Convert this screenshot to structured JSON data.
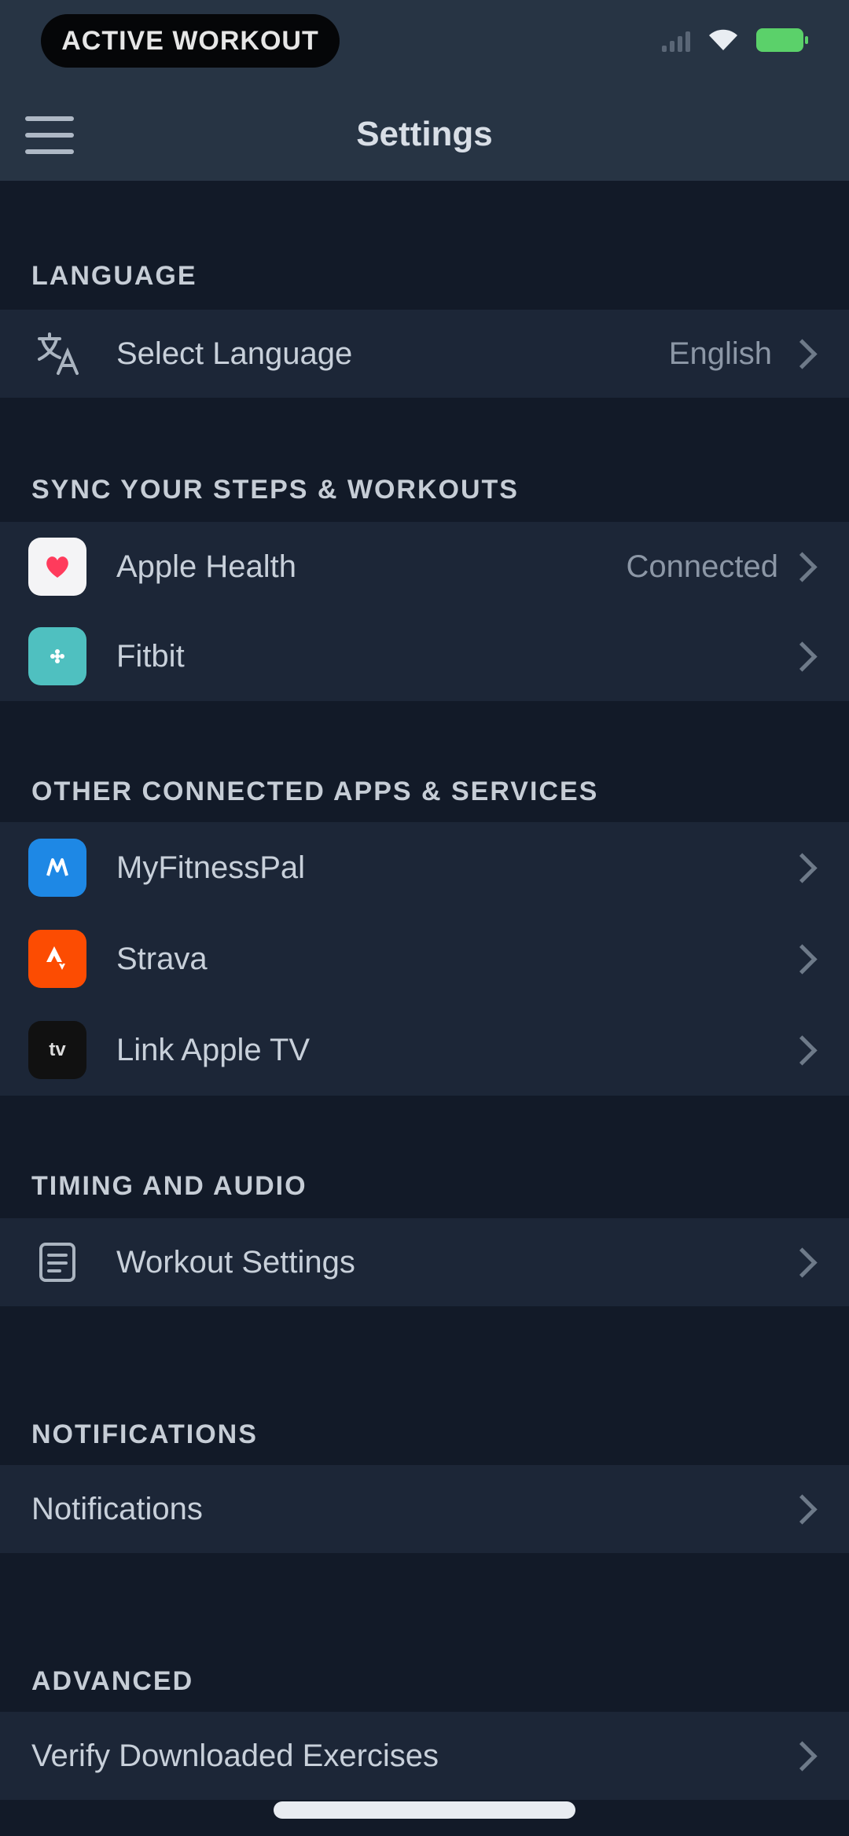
{
  "status_bar": {
    "pill_text": "ACTIVE WORKOUT",
    "battery_color": "#5bd16a"
  },
  "header": {
    "title": "Settings",
    "menu_icon": "hamburger-menu-icon"
  },
  "sections": {
    "language": {
      "title": "LANGUAGE",
      "rows": [
        {
          "label": "Select Language",
          "value": "English",
          "icon": "translate-icon"
        }
      ]
    },
    "sync": {
      "title": "SYNC YOUR STEPS & WORKOUTS",
      "rows": [
        {
          "label": "Apple Health",
          "value": "Connected",
          "icon": "apple-health-icon"
        },
        {
          "label": "Fitbit",
          "value": "",
          "icon": "fitbit-icon"
        }
      ]
    },
    "connected_apps": {
      "title": "OTHER CONNECTED APPS & SERVICES",
      "rows": [
        {
          "label": "MyFitnessPal",
          "icon": "myfitnesspal-icon"
        },
        {
          "label": "Strava",
          "icon": "strava-icon"
        },
        {
          "label": "Link Apple TV",
          "icon": "apple-tv-icon"
        }
      ]
    },
    "timing_audio": {
      "title": "TIMING AND AUDIO",
      "rows": [
        {
          "label": "Workout Settings",
          "icon": "workout-settings-icon"
        }
      ]
    },
    "notifications": {
      "title": "NOTIFICATIONS",
      "rows": [
        {
          "label": "Notifications"
        }
      ]
    },
    "advanced": {
      "title": "ADVANCED",
      "rows": [
        {
          "label": "Verify Downloaded Exercises"
        }
      ]
    }
  },
  "colors": {
    "background": "#121a28",
    "header": "#273444",
    "row": "#1c2637",
    "health": "#ff3b5c",
    "fitbit": "#4fc0c0",
    "myfitnesspal": "#1e88e5",
    "strava": "#fc4c02"
  }
}
